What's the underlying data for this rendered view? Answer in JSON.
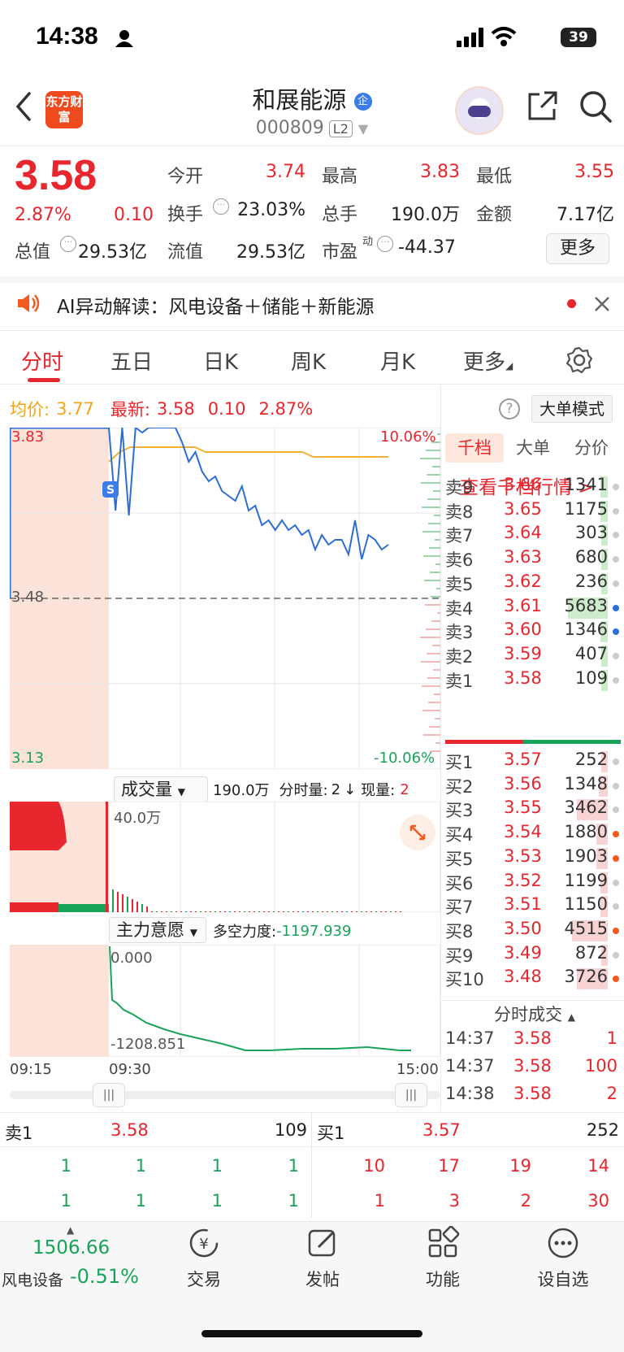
{
  "status_bar": {
    "time": "14:38",
    "battery": "39"
  },
  "header": {
    "logo_text": "东方财富",
    "stock_name": "和展能源",
    "badge": "企",
    "stock_code": "000809",
    "level": "L2"
  },
  "quote": {
    "price": "3.58",
    "change_pct": "2.87%",
    "change": "0.10",
    "open_label": "今开",
    "open": "3.74",
    "high_label": "最高",
    "high": "3.83",
    "low_label": "最低",
    "low": "3.55",
    "turnover_label": "换手",
    "turnover": "23.03%",
    "volume_label": "总手",
    "volume": "190.0万",
    "amount_label": "金额",
    "amount": "7.17亿",
    "mktcap_label": "总值",
    "mktcap": "29.53亿",
    "float_label": "流值",
    "float_cap": "29.53亿",
    "pe_label": "市盈",
    "pe_sup": "动",
    "pe": "-44.37",
    "more_button": "更多"
  },
  "ai_banner": {
    "text": "AI异动解读：风电设备＋储能＋新能源"
  },
  "tabs": [
    "分时",
    "五日",
    "日K",
    "周K",
    "月K",
    "更多"
  ],
  "legend": {
    "avg_label": "均价:",
    "avg": "3.77",
    "latest_label": "最新:",
    "latest": "3.58",
    "change": "0.10",
    "change_pct": "2.87%",
    "mode_button": "大单模式"
  },
  "chart_data": {
    "type": "line",
    "title": "",
    "y_left_ticks": [
      "3.83",
      "3.48",
      "3.13"
    ],
    "y_right_ticks": [
      "10.06%",
      "-10.06%"
    ],
    "ylim": [
      3.13,
      3.83
    ],
    "prev_close": 3.48,
    "x_ticks": [
      "09:15",
      "09:30",
      "15:00"
    ],
    "series": [
      {
        "values": [
          3.83,
          3.66,
          3.83,
          3.65,
          3.83,
          3.82,
          3.83,
          3.83,
          3.83,
          3.83,
          3.83,
          3.8,
          3.76,
          3.78,
          3.74,
          3.72,
          3.73,
          3.7,
          3.69,
          3.68,
          3.71,
          3.66,
          3.67,
          3.63,
          3.64,
          3.62,
          3.64,
          3.62,
          3.63,
          3.61,
          3.62,
          3.58,
          3.61,
          3.59,
          3.6,
          3.6,
          3.57,
          3.64,
          3.56,
          3.61,
          3.6,
          3.58,
          3.59
        ]
      },
      {
        "values": [
          3.76,
          3.78,
          3.79,
          3.79,
          3.79,
          3.79,
          3.79,
          3.79,
          3.79,
          3.78,
          3.78,
          3.78,
          3.78,
          3.78,
          3.78,
          3.78,
          3.78,
          3.78,
          3.78,
          3.77,
          3.77,
          3.77,
          3.77,
          3.77,
          3.77,
          3.77,
          3.77
        ]
      }
    ]
  },
  "volume_panel": {
    "selector": "成交量",
    "total": "190.0万",
    "fenshi_label": "分时量:",
    "fenshi": "2",
    "now_label": "现量:",
    "now": "2",
    "axis_max": "40.0万"
  },
  "mainforce_panel": {
    "selector": "主力意愿",
    "label": "多空力度:",
    "value": "-1197.939",
    "axis_top": "0.000",
    "axis_bottom": "-1208.851"
  },
  "orderbook": {
    "tabs": [
      "千档",
      "大单",
      "分价"
    ],
    "link": "查看千档行情 >",
    "asks": [
      {
        "label": "卖9",
        "price": "3.66",
        "vol": "1341",
        "bar": 0.08,
        "dot": "gray"
      },
      {
        "label": "卖8",
        "price": "3.65",
        "vol": "1175",
        "bar": 0.08,
        "dot": "gray"
      },
      {
        "label": "卖7",
        "price": "3.64",
        "vol": "303",
        "bar": 0.05,
        "dot": "gray"
      },
      {
        "label": "卖6",
        "price": "3.63",
        "vol": "680",
        "bar": 0.07,
        "dot": "gray"
      },
      {
        "label": "卖5",
        "price": "3.62",
        "vol": "236",
        "bar": 0.04,
        "dot": "gray"
      },
      {
        "label": "卖4",
        "price": "3.61",
        "vol": "5683",
        "bar": 0.45,
        "dot": "blue"
      },
      {
        "label": "卖3",
        "price": "3.60",
        "vol": "1346",
        "bar": 0.08,
        "dot": "blue"
      },
      {
        "label": "卖2",
        "price": "3.59",
        "vol": "407",
        "bar": 0.05,
        "dot": "gray"
      },
      {
        "label": "卖1",
        "price": "3.58",
        "vol": "109",
        "bar": 0.03,
        "dot": "gray"
      }
    ],
    "bids": [
      {
        "label": "买1",
        "price": "3.57",
        "vol": "252",
        "bar": 0.03,
        "dot": "gray"
      },
      {
        "label": "买2",
        "price": "3.56",
        "vol": "1348",
        "bar": 0.1,
        "dot": "gray"
      },
      {
        "label": "买3",
        "price": "3.55",
        "vol": "3462",
        "bar": 0.35,
        "dot": "gray"
      },
      {
        "label": "买4",
        "price": "3.54",
        "vol": "1880",
        "bar": 0.13,
        "dot": "orange"
      },
      {
        "label": "买5",
        "price": "3.53",
        "vol": "1903",
        "bar": 0.13,
        "dot": "orange"
      },
      {
        "label": "买6",
        "price": "3.52",
        "vol": "1199",
        "bar": 0.08,
        "dot": "gray"
      },
      {
        "label": "买7",
        "price": "3.51",
        "vol": "1150",
        "bar": 0.08,
        "dot": "gray"
      },
      {
        "label": "买8",
        "price": "3.50",
        "vol": "4515",
        "bar": 0.4,
        "dot": "orange"
      },
      {
        "label": "买9",
        "price": "3.49",
        "vol": "872",
        "bar": 0.06,
        "dot": "gray"
      },
      {
        "label": "买10",
        "price": "3.48",
        "vol": "3726",
        "bar": 0.35,
        "dot": "orange"
      }
    ],
    "ticks_header": "分时成交",
    "ticks": [
      {
        "time": "14:37",
        "price": "3.58",
        "vol": "1"
      },
      {
        "time": "14:37",
        "price": "3.58",
        "vol": "100"
      },
      {
        "time": "14:38",
        "price": "3.58",
        "vol": "2"
      }
    ]
  },
  "summary": {
    "sell_label": "卖1",
    "sell_price": "3.58",
    "sell_vol": "109",
    "buy_label": "买1",
    "buy_price": "3.57",
    "buy_vol": "252",
    "sell_row1": [
      "1",
      "1",
      "1",
      "1"
    ],
    "sell_row2": [
      "1",
      "1",
      "1",
      "1"
    ],
    "buy_row1": [
      "10",
      "17",
      "19",
      "14"
    ],
    "buy_row2": [
      "1",
      "3",
      "2",
      "30"
    ]
  },
  "footer": {
    "sector_value": "1506.66",
    "sector_name": "风电设备",
    "sector_change": "-0.51%",
    "nav": [
      "交易",
      "发帖",
      "功能",
      "设自选"
    ]
  }
}
